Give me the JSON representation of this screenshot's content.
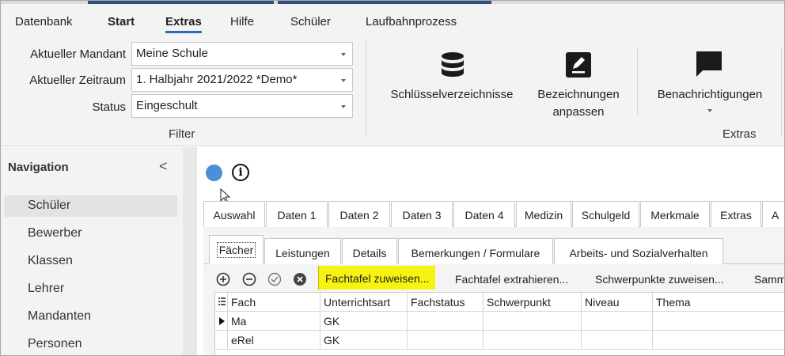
{
  "menu": {
    "tabs": [
      {
        "label": "Datenbank"
      },
      {
        "label": "Start"
      },
      {
        "label": "Extras"
      },
      {
        "label": "Hilfe"
      },
      {
        "label": "Schüler"
      },
      {
        "label": "Laufbahnprozess"
      }
    ],
    "active_tab": "Extras"
  },
  "ribbon": {
    "filter": {
      "mandant_label": "Aktueller Mandant",
      "mandant_value": "Meine Schule",
      "zeitraum_label": "Aktueller Zeitraum",
      "zeitraum_value": "1. Halbjahr 2021/2022 *Demo*",
      "status_label": "Status",
      "status_value": "Eingeschult",
      "group_label": "Filter"
    },
    "buttons": {
      "schluessel": "Schlüsselverzeichnisse",
      "bezeichnungen_line1": "Bezeichnungen",
      "bezeichnungen_line2": "anpassen",
      "benachrichtigungen": "Benachrichtigungen"
    },
    "extras_group_label": "Extras"
  },
  "navigation": {
    "title": "Navigation",
    "collapse_glyph": "<",
    "items": [
      {
        "label": "Schüler"
      },
      {
        "label": "Bewerber"
      },
      {
        "label": "Klassen"
      },
      {
        "label": "Lehrer"
      },
      {
        "label": "Mandanten"
      },
      {
        "label": "Personen"
      }
    ],
    "selected": "Schüler"
  },
  "main": {
    "info_glyph": "i",
    "tabs": [
      {
        "label": "Auswahl"
      },
      {
        "label": "Daten 1"
      },
      {
        "label": "Daten 2"
      },
      {
        "label": "Daten 3"
      },
      {
        "label": "Daten 4"
      },
      {
        "label": "Medizin"
      },
      {
        "label": "Schulgeld"
      },
      {
        "label": "Merkmale"
      },
      {
        "label": "Extras"
      },
      {
        "label": "A"
      }
    ],
    "subtabs": [
      {
        "label": "Fächer"
      },
      {
        "label": "Leistungen"
      },
      {
        "label": "Details"
      },
      {
        "label": "Bemerkungen / Formulare"
      },
      {
        "label": "Arbeits- und Sozialverhalten"
      }
    ],
    "active_subtab": "Fächer",
    "toolbar": {
      "fachtafel_zuweisen": "Fachtafel zuweisen...",
      "fachtafel_extrahieren": "Fachtafel extrahieren...",
      "schwerpunkte_zuweisen": "Schwerpunkte zuweisen...",
      "sammel": "Samm"
    },
    "grid": {
      "columns": [
        "Fach",
        "Unterrichtsart",
        "Fachstatus",
        "Schwerpunkt",
        "Niveau",
        "Thema"
      ],
      "rows": [
        {
          "fach": "Ma",
          "unterrichtsart": "GK",
          "current": true
        },
        {
          "fach": "eRel",
          "unterrichtsart": "GK",
          "current": false
        }
      ]
    }
  },
  "colors": {
    "accent_blue": "#2c6bbf",
    "status_dot": "#4a8fd8",
    "highlight_yellow": "#f6f312",
    "ribbon_bg": "#f3f3f3"
  },
  "icons": [
    "database-icon",
    "edit-label-icon",
    "chat-icon",
    "info-icon",
    "add-icon",
    "remove-icon",
    "check-icon",
    "cancel-icon",
    "grid-menu-icon",
    "row-pointer-icon"
  ]
}
